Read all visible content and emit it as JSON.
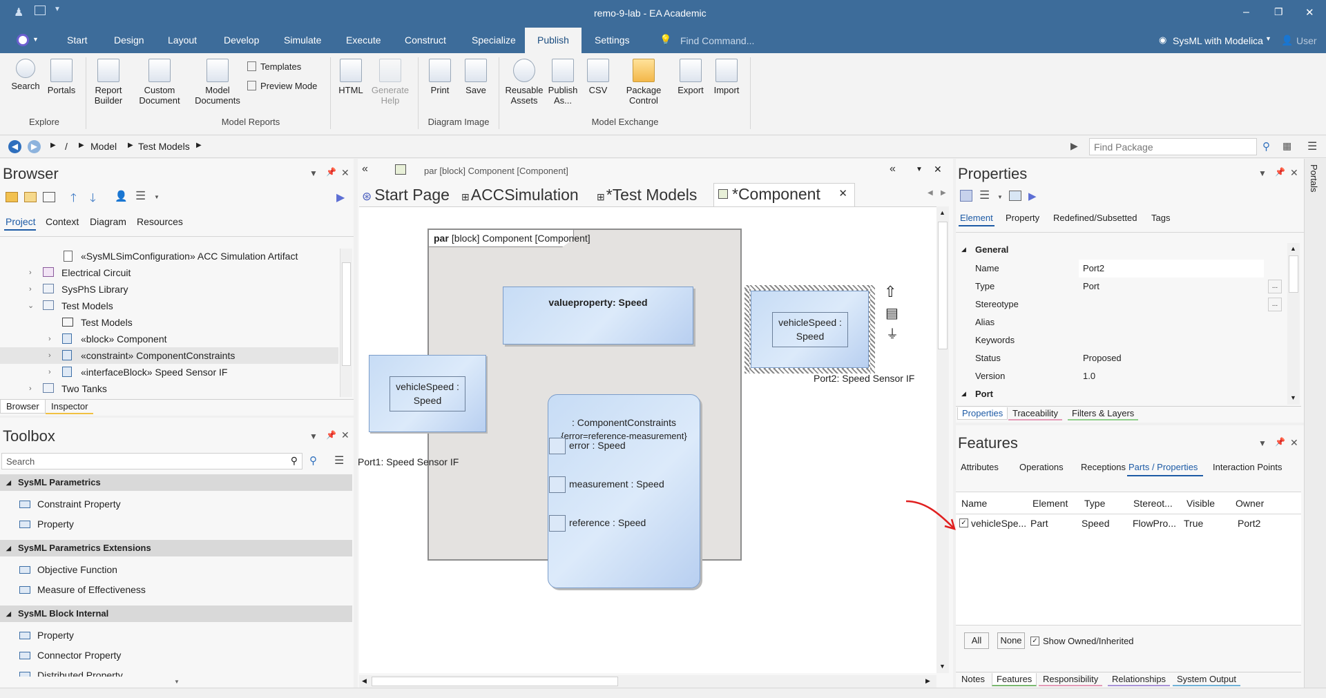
{
  "window": {
    "title": "remo-9-lab - EA Academic",
    "min": "–",
    "max": "❐",
    "close": "✕"
  },
  "menu": {
    "items": [
      "Start",
      "Design",
      "Layout",
      "Develop",
      "Simulate",
      "Execute",
      "Construct",
      "Specialize",
      "Publish",
      "Settings"
    ],
    "find_placeholder": "Find Command...",
    "perspective": "SysML with Modelica",
    "user": "User"
  },
  "ribbon": {
    "buttons": {
      "search": "Search",
      "portals": "Portals",
      "report_builder": "Report Builder",
      "custom_document": "Custom Document",
      "model_documents": "Model Documents",
      "templates": "Templates",
      "preview_mode": "Preview Mode",
      "html": "HTML",
      "generate_help": "Generate Help",
      "print": "Print",
      "save": "Save",
      "reusable_assets": "Reusable Assets",
      "publish_as": "Publish As...",
      "csv": "CSV",
      "package_control": "Package Control",
      "export": "Export",
      "import": "Import"
    },
    "groups": {
      "explore": "Explore",
      "model_reports": "Model Reports",
      "diagram_image": "Diagram Image",
      "model_exchange": "Model Exchange"
    }
  },
  "address": {
    "crumbs": [
      "/",
      "Model",
      "Test Models"
    ],
    "find_package_placeholder": "Find Package"
  },
  "browser": {
    "title": "Browser",
    "tabs": [
      "Project",
      "Context",
      "Diagram",
      "Resources"
    ],
    "tree": [
      "«SysMLSimConfiguration» ACC Simulation Artifact",
      "Electrical Circuit",
      "SysPhS Library",
      "Test Models",
      "Test Models",
      "«block» Component",
      "«constraint» ComponentConstraints",
      "«interfaceBlock» Speed Sensor IF",
      "Two Tanks"
    ],
    "bottom_tabs": [
      "Browser",
      "Inspector"
    ]
  },
  "toolbox": {
    "title": "Toolbox",
    "search_placeholder": "Search",
    "sections": [
      {
        "header": "SysML Parametrics",
        "items": [
          "Constraint Property",
          "Property"
        ]
      },
      {
        "header": "SysML Parametrics Extensions",
        "items": [
          "Objective Function",
          "Measure of Effectiveness"
        ]
      },
      {
        "header": "SysML Block Internal",
        "items": [
          "Property",
          "Connector Property",
          "Distributed Property"
        ]
      }
    ]
  },
  "diagram": {
    "header": "par [block] Component [Component]",
    "tabs": [
      "Start Page",
      "ACCSimulation",
      "*Test Models",
      "*Component"
    ],
    "frame_label_bold": "par",
    "frame_label_rest": " [block] Component [Component]",
    "value_property": "valueproperty: Speed",
    "port1_inner": [
      "vehicleSpeed :",
      "Speed"
    ],
    "port1_label": "Port1: Speed Sensor IF",
    "port2_inner": [
      "vehicleSpeed :",
      "Speed"
    ],
    "port2_label": "Port2: Speed Sensor IF",
    "constraint_name": ": ComponentConstraints",
    "constraint_expr": "{error=reference-measurement}",
    "params": [
      "error : Speed",
      "measurement : Speed",
      "reference : Speed"
    ]
  },
  "properties": {
    "title": "Properties",
    "tabs": [
      "Element",
      "Property",
      "Redefined/Subsetted",
      "Tags"
    ],
    "section_general": "General",
    "rows": [
      {
        "k": "Name",
        "v": "Port2"
      },
      {
        "k": "Type",
        "v": "Port"
      },
      {
        "k": "Stereotype",
        "v": ""
      },
      {
        "k": "Alias",
        "v": ""
      },
      {
        "k": "Keywords",
        "v": ""
      },
      {
        "k": "Status",
        "v": "Proposed"
      },
      {
        "k": "Version",
        "v": "1.0"
      }
    ],
    "section_port": "Port",
    "bottom_tabs": [
      "Properties",
      "Traceability",
      "Filters & Layers"
    ]
  },
  "features": {
    "title": "Features",
    "tabs": [
      "Attributes",
      "Operations",
      "Receptions",
      "Parts / Properties",
      "Interaction Points"
    ],
    "columns": [
      "Name",
      "Element",
      "Type",
      "Stereot...",
      "Visible",
      "Owner"
    ],
    "rows": [
      [
        "vehicleSpe...",
        "Part",
        "Speed",
        "FlowPro...",
        "True",
        "Port2"
      ]
    ],
    "btn_all": "All",
    "btn_none": "None",
    "show_owned": "Show Owned/Inherited",
    "bottom_tabs": [
      "Notes",
      "Features",
      "Responsibility",
      "Relationships",
      "System Output"
    ]
  },
  "side": {
    "portals": "Portals"
  }
}
